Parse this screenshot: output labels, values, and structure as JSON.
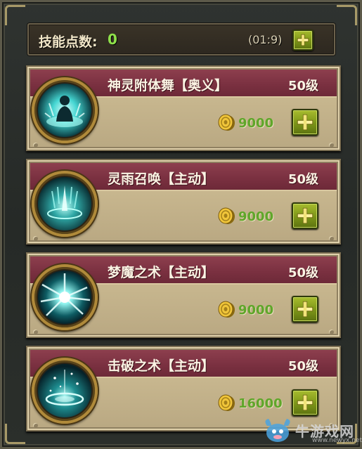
{
  "header": {
    "label": "技能点数:",
    "points": "0",
    "timer": "(01:9)"
  },
  "skills": [
    {
      "name": "神灵附体舞【奥义】",
      "level": "50级",
      "cost": "9000",
      "icon": "spirit-dance-icon"
    },
    {
      "name": "灵雨召唤【主动】",
      "level": "50级",
      "cost": "9000",
      "icon": "spirit-rain-icon"
    },
    {
      "name": "梦魔之术【主动】",
      "level": "50级",
      "cost": "9000",
      "icon": "nightmare-burst-icon"
    },
    {
      "name": "击破之术【主动】",
      "level": "50级",
      "cost": "16000",
      "icon": "break-technique-icon"
    }
  ],
  "watermark": {
    "text": "牛游戏网",
    "url": "www.newyx.net"
  },
  "colors": {
    "points_green": "#8ee04a",
    "cost_green": "#5fa62a",
    "banner_red": "#7b3141",
    "parchment": "#c7b68e",
    "button_green": "#7b9418",
    "glow_cyan": "#5ff0e6"
  }
}
